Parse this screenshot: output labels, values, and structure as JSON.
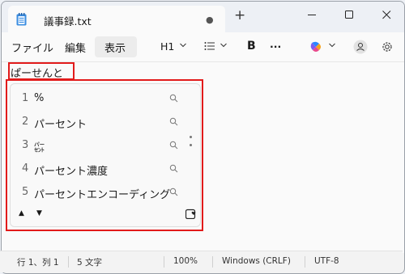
{
  "tab": {
    "title": "議事録.txt",
    "unsaved_dot": "●",
    "new_tab": "+"
  },
  "menu": {
    "file": "ファイル",
    "edit": "編集",
    "view": "表示"
  },
  "toolbar": {
    "heading": "H1",
    "bold": "B",
    "more": "···"
  },
  "editor": {
    "typed_text": "ぱーせんと"
  },
  "ime": {
    "candidates": [
      {
        "num": "1",
        "text": "%"
      },
      {
        "num": "2",
        "text": "パーセント"
      },
      {
        "num": "3",
        "text": "㌫"
      },
      {
        "num": "4",
        "text": "パーセント濃度"
      },
      {
        "num": "5",
        "text": "パーセントエンコーディング"
      }
    ],
    "up": "▲",
    "down": "▼"
  },
  "status": {
    "position": "行 1、列 1",
    "chars": "5 文字",
    "zoom": "100%",
    "line_ending": "Windows (CRLF)",
    "encoding": "UTF-8"
  },
  "colors": {
    "highlight_border": "#e21b1b",
    "notepad_icon": "#2f7fd1"
  }
}
